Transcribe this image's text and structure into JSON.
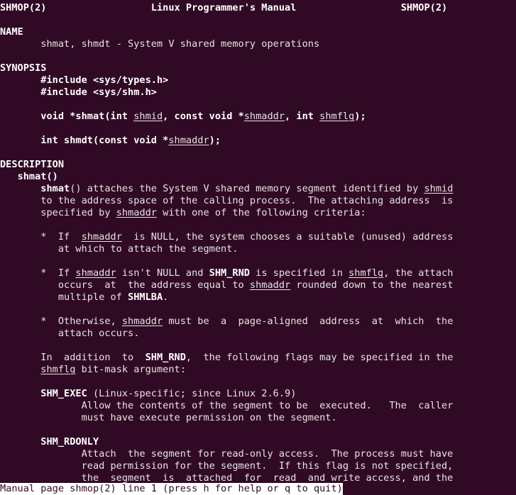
{
  "terminal": {
    "background_color": "#300a24",
    "foreground_color": "#e8e3e3",
    "columns": 80,
    "rows": 41
  },
  "manpage": {
    "header": {
      "left": "SHMOP(2)",
      "center": "Linux Programmer's Manual",
      "right": "SHMOP(2)"
    },
    "sections": [
      {
        "heading": "NAME",
        "body": "shmat, shmdt - System V shared memory operations"
      },
      {
        "heading": "SYNOPSIS",
        "lines": [
          "#include <sys/types.h>",
          "#include <sys/shm.h>",
          "void *shmat(int shmid, const void *shmaddr, int shmflg);",
          "int shmdt(const void *shmaddr);"
        ]
      },
      {
        "heading": "DESCRIPTION",
        "subheading": "shmat()",
        "paragraphs": [
          "shmat() attaches the System V shared memory segment identified by shmid to the address space of the calling process.  The attaching address  is specified by shmaddr with one of the following criteria:",
          "*  If  shmaddr  is NULL, the system chooses a suitable (unused) address at which to attach the segment.",
          "*  If shmaddr isn't NULL and SHM_RND is specified in shmflg, the attach occurs  at  the address equal to shmaddr rounded down to the nearest multiple of SHMLBA.",
          "*  Otherwise, shmaddr must be  a  page-aligned  address  at  which  the attach occurs.",
          "In  addition  to  SHM_RND,  the following flags may be specified in the shmflg bit-mask argument:"
        ],
        "flags": [
          {
            "name": "SHM_EXEC",
            "note": "(Linux-specific; since Linux 2.6.9)",
            "description": "Allow the contents of the segment to be  executed.   The  caller must have execute permission on the segment."
          },
          {
            "name": "SHM_RDONLY",
            "note": "",
            "description": "Attach  the segment for read-only access.  The process must have read permission for the segment.  If this flag is not specified, the  segment  is  attached  for  read  and write access, and the"
          }
        ]
      }
    ],
    "raw_lines": [
      "SHMOP(2)                  Linux Programmer's Manual                  SHMOP(2)",
      "",
      "NAME",
      "       shmat, shmdt - System V shared memory operations",
      "",
      "SYNOPSIS",
      "       #include <sys/types.h>",
      "       #include <sys/shm.h>",
      "",
      "       void *shmat(int shmid, const void *shmaddr, int shmflg);",
      "",
      "       int shmdt(const void *shmaddr);",
      "",
      "DESCRIPTION",
      "   shmat()",
      "       shmat() attaches the System V shared memory segment identified by shmid",
      "       to the address space of the calling process.  The attaching address  is",
      "       specified by shmaddr with one of the following criteria:",
      "",
      "       *  If  shmaddr  is NULL, the system chooses a suitable (unused) address",
      "          at which to attach the segment.",
      "",
      "       *  If shmaddr isn't NULL and SHM_RND is specified in shmflg, the attach",
      "          occurs  at  the address equal to shmaddr rounded down to the nearest",
      "          multiple of SHMLBA.",
      "",
      "       *  Otherwise, shmaddr must be  a  page-aligned  address  at  which  the",
      "          attach occurs.",
      "",
      "       In  addition  to  SHM_RND,  the following flags may be specified in the",
      "       shmflg bit-mask argument:",
      "",
      "       SHM_EXEC (Linux-specific; since Linux 2.6.9)",
      "              Allow the contents of the segment to be  executed.   The  caller",
      "              must have execute permission on the segment.",
      "",
      "       SHM_RDONLY",
      "              Attach  the segment for read-only access.  The process must have",
      "              read permission for the segment.  If this flag is not specified,",
      "              the  segment  is  attached  for  read  and write access, and the"
    ]
  },
  "status_bar": {
    "text": "Manual page shmop(2) line 1 (press h for help or q to quit)",
    "background_color": "#ffffff",
    "text_color": "#300a24"
  }
}
